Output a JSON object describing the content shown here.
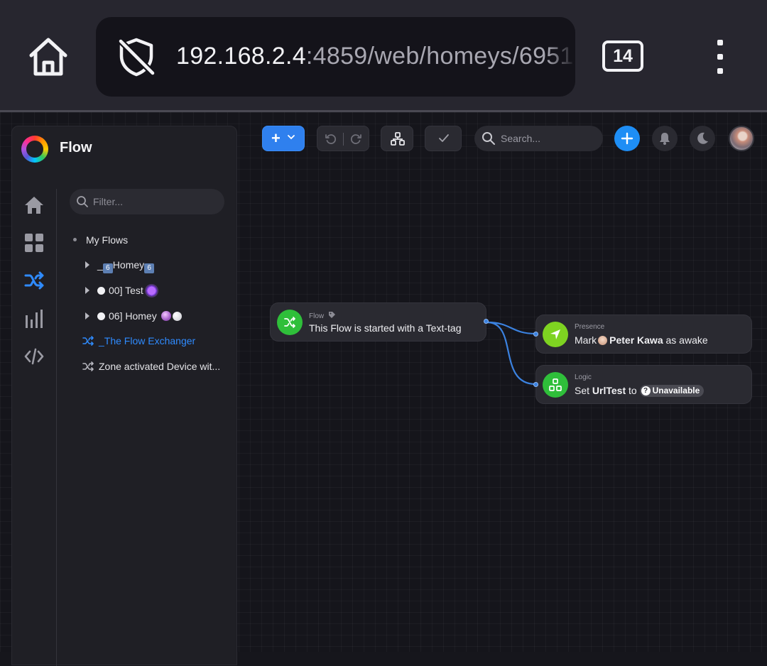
{
  "browser": {
    "url_main": "192.168.2.4",
    "url_rest": ":4859/web/homeys/6951",
    "tab_count": "14"
  },
  "panel": {
    "title": "Flow",
    "filter_placeholder": "Filter...",
    "root_label": "My Flows",
    "folders": [
      {
        "prefix": "_",
        "badge_left": "6",
        "name": "Homey",
        "badge_right": "6"
      },
      {
        "name": "00] Test"
      },
      {
        "name": "06] Homey"
      }
    ],
    "flows": [
      {
        "name": "_The Flow Exchanger",
        "active": true
      },
      {
        "name": "Zone activated Device wit...",
        "active": false
      }
    ]
  },
  "toolbar": {
    "search_placeholder": "Search..."
  },
  "cards": {
    "trigger": {
      "label": "Flow",
      "text": "This Flow is started with a Text-tag",
      "color": "#2fbf3a"
    },
    "presence": {
      "label": "Presence",
      "text_pre": "Mark",
      "person": "Peter Kawa",
      "text_post": "as awake",
      "color": "#7ed321"
    },
    "logic": {
      "label": "Logic",
      "text_pre": "Set",
      "variable": "UrlTest",
      "text_mid": "to",
      "token": "Unavailable",
      "color": "#2fbf3a"
    }
  },
  "colors": {
    "accent": "#2f80ee",
    "active_text": "#2f8bff",
    "connector": "#3b82e0"
  }
}
